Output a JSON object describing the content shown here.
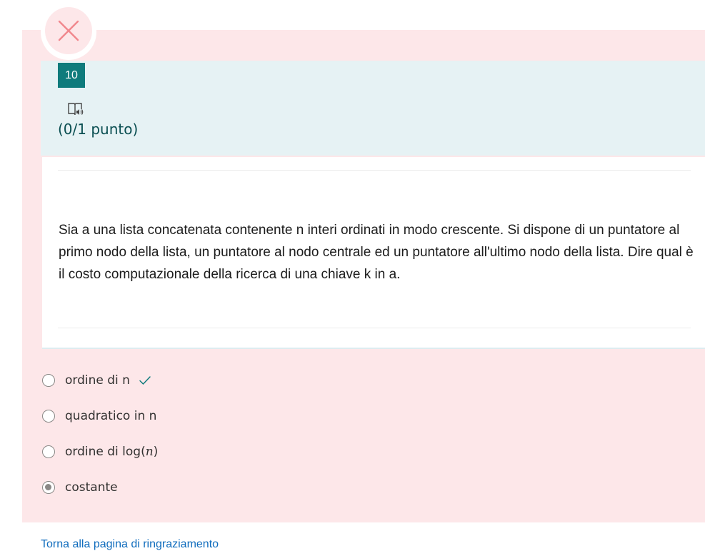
{
  "question": {
    "number": "10",
    "points": "(0/1 punto)",
    "text_html": "Sia a una lista concatenata contenente n interi ordinati in modo crescente. Si dispone di un puntatore al primo nodo della lista, un puntatore al nodo centrale ed un puntatore all'ultimo nodo della lista. Dire qual è il costo computazionale della ricerca di una chiave k in a."
  },
  "options": [
    {
      "label": "ordine di n",
      "correct": true,
      "selected": false
    },
    {
      "label": "quadratico in n",
      "correct": false,
      "selected": false
    },
    {
      "label_prefix": "ordine di log(",
      "label_math": "n",
      "label_suffix": ")",
      "correct": false,
      "selected": false
    },
    {
      "label": "costante",
      "correct": false,
      "selected": true
    }
  ],
  "footer": {
    "link_text": "Torna alla pagina di ringraziamento"
  },
  "icons": {
    "status": "close-icon",
    "reader": "immersive-reader-icon",
    "correct": "checkmark-icon"
  },
  "colors": {
    "card_bg": "#fde7e9",
    "header_bg": "#e6f2f4",
    "badge": "#0f7b7c",
    "wrong_x": "#f1878d",
    "check": "#0f7b7c"
  }
}
